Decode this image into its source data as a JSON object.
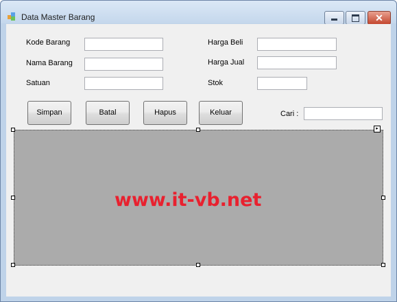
{
  "window": {
    "title": "Data Master Barang",
    "close_glyph": "✕"
  },
  "form": {
    "labels": {
      "kode_barang": "Kode Barang",
      "nama_barang": "Nama Barang",
      "satuan": "Satuan",
      "harga_beli": "Harga Beli",
      "harga_jual": "Harga Jual",
      "stok": "Stok",
      "cari": "Cari :"
    },
    "values": {
      "kode_barang": "",
      "nama_barang": "",
      "satuan": "",
      "harga_beli": "",
      "harga_jual": "",
      "stok": "",
      "cari": ""
    }
  },
  "buttons": {
    "simpan": "Simpan",
    "batal": "Batal",
    "hapus": "Hapus",
    "keluar": "Keluar"
  },
  "grid": {
    "watermark": "www.it-vb.net",
    "watermark_color": "#e8212f",
    "background_color": "#ababab"
  },
  "icons": {
    "app": "app-icon",
    "minimize": "minimize-icon",
    "maximize": "maximize-icon",
    "close": "close-icon",
    "smart_tag": "smart-tag-arrow-icon"
  }
}
